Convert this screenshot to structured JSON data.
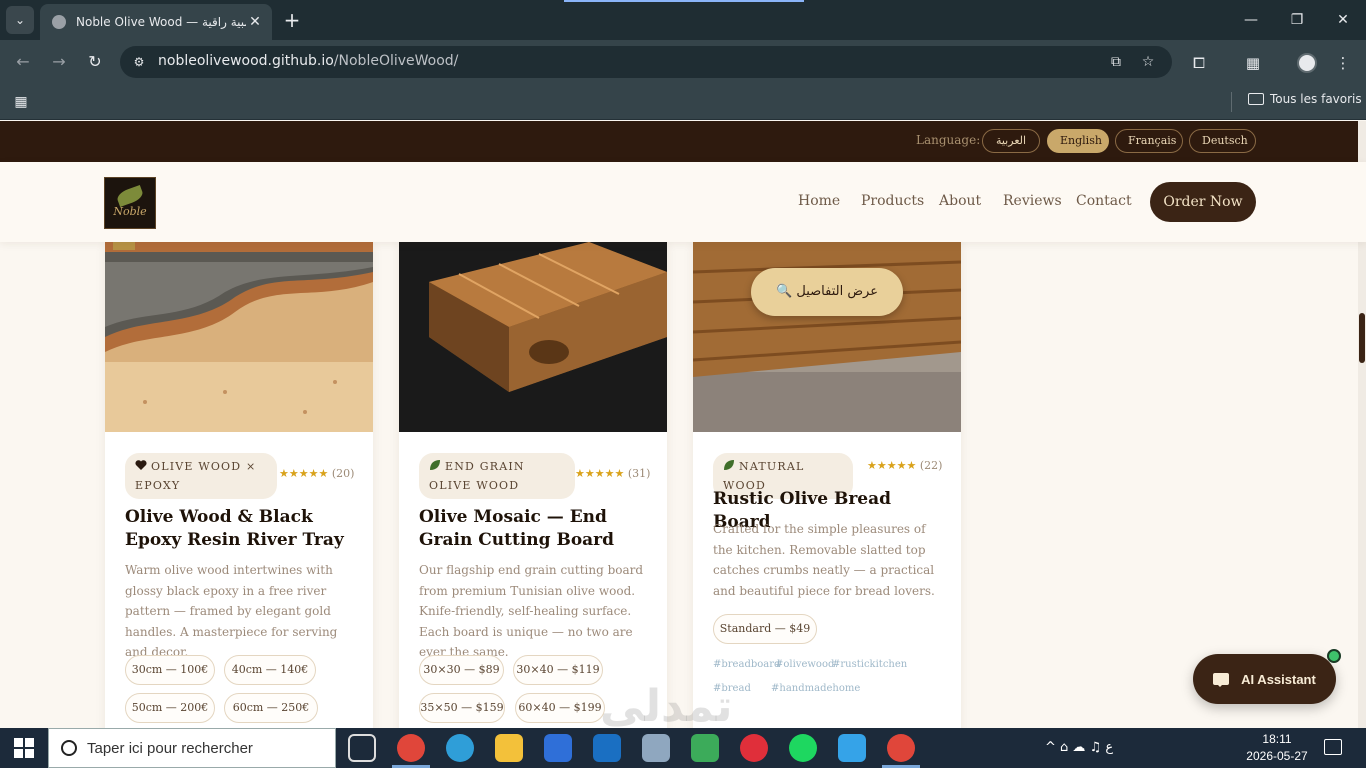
{
  "browser": {
    "tab_title": "Noble Olive Wood — خشبية راقية",
    "tab_close": "✕",
    "new_tab": "+",
    "url_host": "nobleolivewood.github.io",
    "url_path": "/NobleOliveWood/",
    "all_bookmarks": "Tous les favoris",
    "window_minimize": "—",
    "window_restore": "❐",
    "window_close": "✕"
  },
  "langbar": {
    "label": "Language:",
    "options": [
      "العربية",
      "English",
      "Français",
      "Deutsch"
    ],
    "active": "English"
  },
  "header": {
    "logo_text": "Noble",
    "nav": [
      "Home",
      "Products",
      "About",
      "Reviews",
      "Contact"
    ],
    "order_button": "Order Now"
  },
  "cards": [
    {
      "badge": "OLIVE WOOD × EPOXY",
      "badge_icon": "heart-icon",
      "stars": "★★★★★",
      "reviews": "(20)",
      "title": "Olive Wood & Black Epoxy Resin River Tray",
      "description": "Warm olive wood intertwines with glossy black epoxy in a free river pattern — framed by elegant gold handles. A masterpiece for serving and decor.",
      "sizes": [
        "30cm — 100€",
        "40cm — 140€",
        "50cm — 200€",
        "60cm — 250€"
      ]
    },
    {
      "badge": "END GRAIN OLIVE WOOD",
      "badge_icon": "leaf-icon",
      "stars": "★★★★★",
      "reviews": "(31)",
      "title": "Olive Mosaic — End Grain Cutting Board",
      "description": "Our flagship end grain cutting board from premium Tunisian olive wood. Knife-friendly, self-healing surface. Each board is unique — no two are ever the same.",
      "sizes": [
        "30×30 — $89",
        "30×40 — $119",
        "35×50 — $159",
        "60×40 — $199"
      ]
    },
    {
      "badge": "NATURAL WOOD",
      "badge_icon": "leaf-icon",
      "stars": "★★★★★",
      "reviews": "(22)",
      "title": "Rustic Olive Bread Board",
      "description": "Crafted for the simple pleasures of the kitchen. Removable slatted top catches crumbs neatly — a practical and beautiful piece for bread lovers.",
      "sizes": [
        "Standard — $49"
      ],
      "tags": [
        "#breadboard",
        "#olivewood",
        "#rustickitchen",
        "#bread",
        "#handmadehome"
      ],
      "details_button": "عرض التفاصيل"
    }
  ],
  "assistant": {
    "label": "AI Assistant"
  },
  "watermark": "تمدلى",
  "taskbar": {
    "search_placeholder": "Taper ici pour rechercher",
    "tray": "^ ⌂ ☁ ♫ ع",
    "time": "18:11",
    "date": "2026-05-27"
  },
  "colors": {
    "brand_dark": "#2e1a0e",
    "accent_gold": "#c9a86a",
    "star": "#d9a21b"
  }
}
